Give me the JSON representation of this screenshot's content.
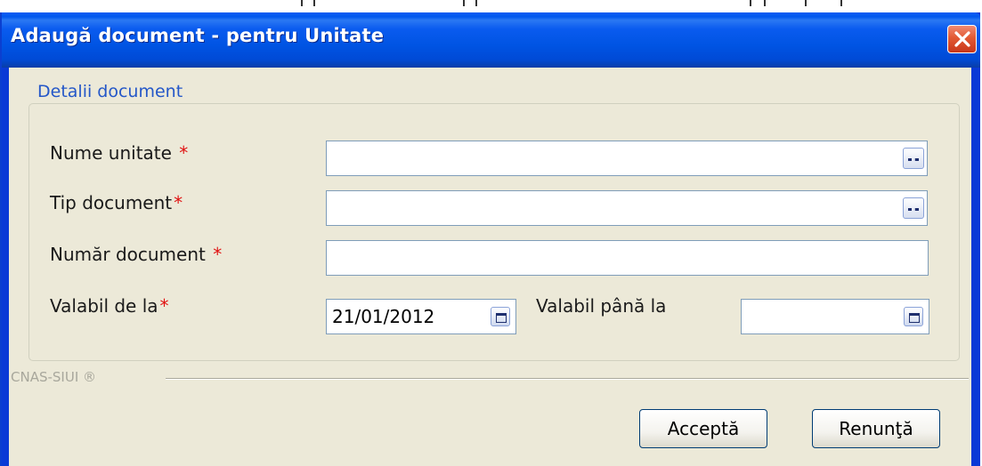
{
  "window": {
    "title": "Adaugă document - pentru Unitate",
    "close_icon": "close-icon"
  },
  "group": {
    "legend": "Detalii document"
  },
  "form": {
    "nume_unitate_label": "Nume unitate ",
    "tip_document_label": "Tip document",
    "numar_document_label": "Număr document ",
    "valabil_de_la_label": "Valabil de la",
    "valabil_pana_la_label": "Valabil până la",
    "required_mark": "*",
    "nume_unitate_value": "",
    "tip_document_value": "",
    "numar_document_value": "",
    "valabil_de_la_value": "21/01/2012",
    "valabil_pana_la_value": ""
  },
  "footer": {
    "brand": "CNAS-SIUI ®"
  },
  "buttons": {
    "accept": "Acceptă",
    "cancel": "Renunţă"
  },
  "colors": {
    "title_bar": "#0054e3",
    "legend_text": "#2457c8",
    "required_star": "#e01010",
    "close_button": "#e25a34"
  }
}
